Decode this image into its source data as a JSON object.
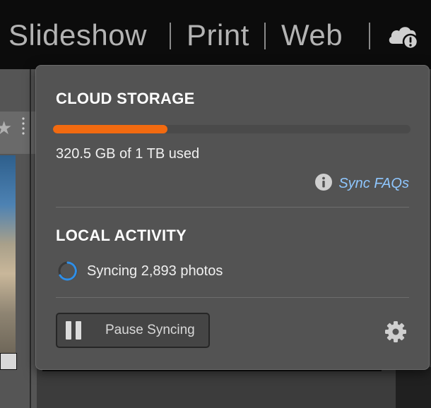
{
  "module_bar": {
    "modules": [
      "Slideshow",
      "Print",
      "Web"
    ],
    "cloud_status_icon": "cloud-alert-icon"
  },
  "background": {
    "star_icon": "star-icon",
    "more_icon": "vertical-dots-icon"
  },
  "popover": {
    "cloud_storage": {
      "title": "CLOUD STORAGE",
      "usage_text": "320.5 GB of 1 TB used",
      "used_fraction": 0.32,
      "bar_color": "#f26a10",
      "faq_icon": "info-icon",
      "faq_label": "Sync FAQs"
    },
    "local_activity": {
      "title": "LOCAL ACTIVITY",
      "spinner_icon": "sync-spinner-icon",
      "status_text": "Syncing 2,893 photos"
    },
    "footer": {
      "pause_icon": "pause-icon",
      "pause_label": "Pause Syncing",
      "settings_icon": "gear-icon"
    }
  }
}
